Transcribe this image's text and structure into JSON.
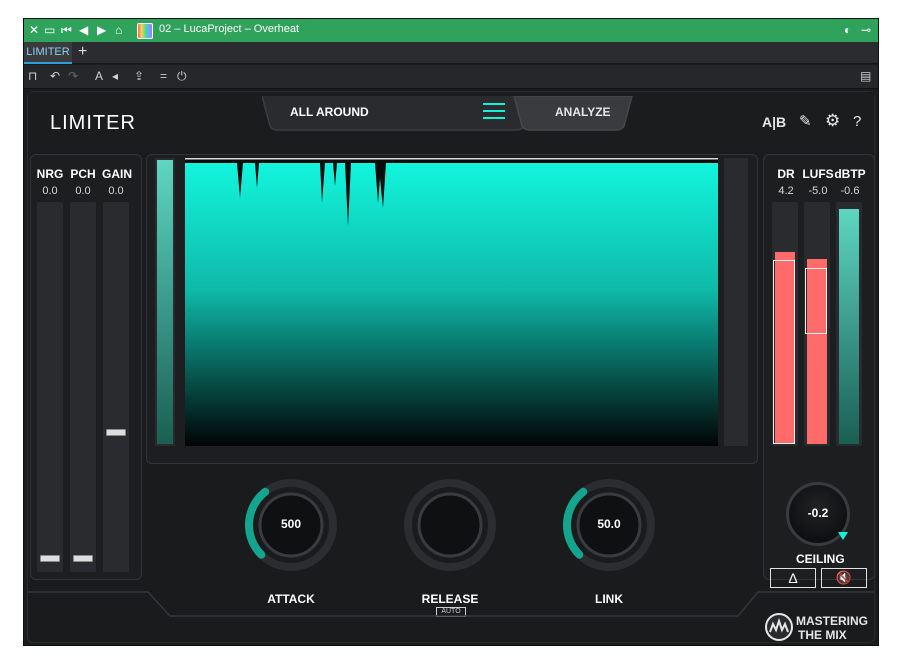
{
  "window": {
    "title": "02 – LucaProject – Overheat",
    "tab_label": "LIMITER",
    "tab_add": "+"
  },
  "plugin": {
    "name": "LIMITER",
    "preset": "ALL AROUND",
    "analyze_label": "ANALYZE",
    "ab_label": "A|B",
    "help_label": "?",
    "left_meters": [
      {
        "label": "NRG",
        "value": "0.0",
        "handle_fraction": 0.02
      },
      {
        "label": "PCH",
        "value": "0.0",
        "handle_fraction": 0.02
      },
      {
        "label": "GAIN",
        "value": "0.0",
        "handle_fraction": 0.36
      }
    ],
    "right_meters": [
      {
        "label": "DR",
        "value": "4.2",
        "fill_fraction": 0.8
      },
      {
        "label": "LUFS",
        "value": "-5.0",
        "fill_fraction": 0.77
      },
      {
        "label": "dBTP",
        "value": "-0.6",
        "fill_fraction": 0.98
      }
    ],
    "ceiling": {
      "value": "-0.2",
      "label": "CEILING"
    },
    "knobs": [
      {
        "value": "500",
        "label": "ATTACK",
        "arc_fraction": 0.45
      },
      {
        "value": "",
        "label": "RELEASE",
        "arc_fraction": 0
      },
      {
        "value": "50.0",
        "label": "LINK",
        "arc_fraction": 0.45
      }
    ],
    "release_auto": "AUTO",
    "brand_line1": "MASTERING",
    "brand_line2": "THE MIX",
    "colors": {
      "accent": "#15f0d8",
      "red": "#ff6b6b",
      "window_green": "#2fa35c"
    }
  }
}
